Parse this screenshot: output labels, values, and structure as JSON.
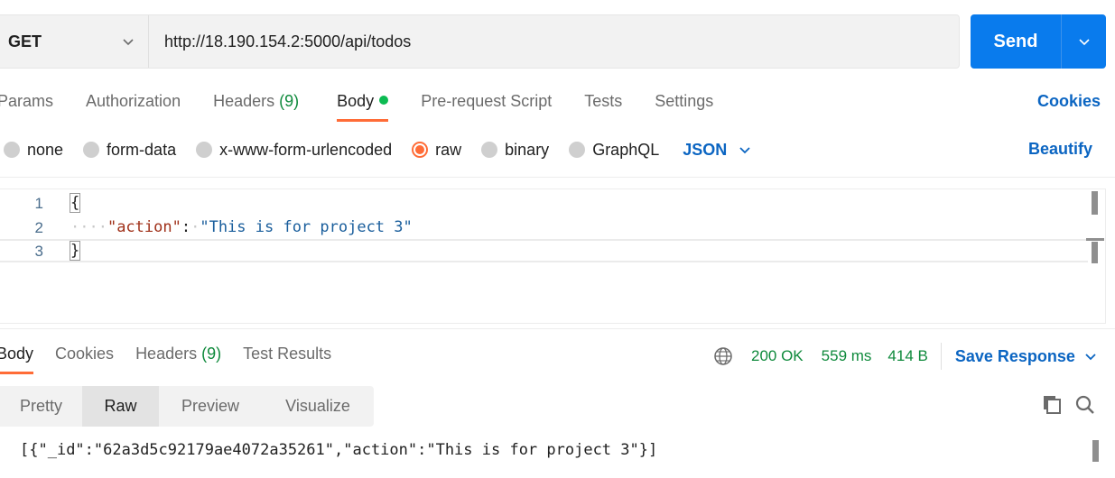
{
  "request": {
    "method": "GET",
    "url": "http://18.190.154.2:5000/api/todos",
    "send_label": "Send"
  },
  "request_tabs": [
    {
      "label": "Params"
    },
    {
      "label": "Authorization"
    },
    {
      "label": "Headers",
      "count": "(9)"
    },
    {
      "label": "Body",
      "active": true
    },
    {
      "label": "Pre-request Script"
    },
    {
      "label": "Tests"
    },
    {
      "label": "Settings"
    }
  ],
  "cookies_label": "Cookies",
  "body_types": [
    {
      "label": "none"
    },
    {
      "label": "form-data"
    },
    {
      "label": "x-www-form-urlencoded"
    },
    {
      "label": "raw",
      "selected": true
    },
    {
      "label": "binary"
    },
    {
      "label": "GraphQL"
    }
  ],
  "language": "JSON",
  "beautify_label": "Beautify",
  "editor": {
    "lines": [
      {
        "num": "1",
        "text": "{"
      },
      {
        "num": "2",
        "key": "\"action\"",
        "value": "\"This is for project 3\""
      },
      {
        "num": "3",
        "text": "}"
      }
    ]
  },
  "response_tabs": [
    {
      "label": "Body",
      "active": true
    },
    {
      "label": "Cookies"
    },
    {
      "label": "Headers",
      "count": "(9)"
    },
    {
      "label": "Test Results"
    }
  ],
  "response_status": {
    "status": "200 OK",
    "time": "559 ms",
    "size": "414 B",
    "save_label": "Save Response"
  },
  "response_views": [
    "Pretty",
    "Raw",
    "Preview",
    "Visualize"
  ],
  "active_response_view": "Raw",
  "response_body": "{\"_id\":\"62a3d5c92179ae4072a35261\",\"action\":\"This is for project 3\"}",
  "colors": {
    "accent": "#ff6c37",
    "primary_blue": "#097bed",
    "link_blue": "#0b65c2",
    "success_green": "#0f8a3c"
  }
}
